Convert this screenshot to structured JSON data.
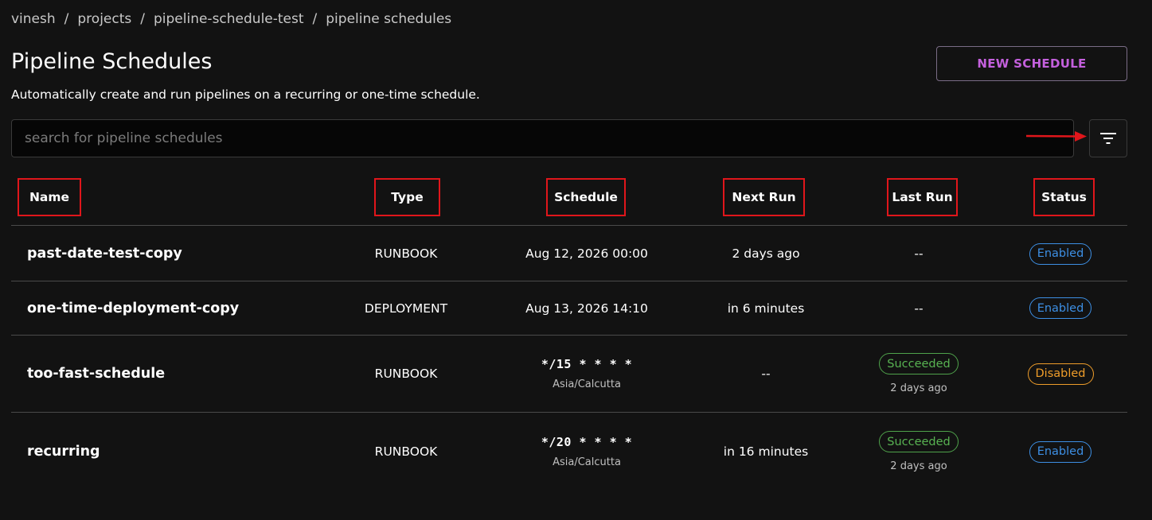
{
  "breadcrumb": {
    "items": [
      "vinesh",
      "projects",
      "pipeline-schedule-test",
      "pipeline schedules"
    ],
    "separator": "/"
  },
  "header": {
    "title": "Pipeline Schedules",
    "subtitle": "Automatically create and run pipelines on a recurring or one-time schedule.",
    "new_button_label": "NEW SCHEDULE"
  },
  "search": {
    "placeholder": "search for pipeline schedules",
    "value": ""
  },
  "filter": {
    "icon": "filter-icon"
  },
  "table": {
    "columns": [
      "Name",
      "Type",
      "Schedule",
      "Next Run",
      "Last Run",
      "Status"
    ],
    "rows": [
      {
        "name": "past-date-test-copy",
        "type": "RUNBOOK",
        "schedule": "Aug 12, 2026 00:00",
        "timezone": "",
        "next_run": "2 days ago",
        "last_run_status": "",
        "last_run_text": "--",
        "last_run_ago": "",
        "status": "Enabled"
      },
      {
        "name": "one-time-deployment-copy",
        "type": "DEPLOYMENT",
        "schedule": "Aug 13, 2026 14:10",
        "timezone": "",
        "next_run": "in 6 minutes",
        "last_run_status": "",
        "last_run_text": "--",
        "last_run_ago": "",
        "status": "Enabled"
      },
      {
        "name": "too-fast-schedule",
        "type": "RUNBOOK",
        "schedule": "*/15 * * * *",
        "timezone": "Asia/Calcutta",
        "next_run": "--",
        "last_run_status": "Succeeded",
        "last_run_text": "",
        "last_run_ago": "2 days ago",
        "status": "Disabled"
      },
      {
        "name": "recurring",
        "type": "RUNBOOK",
        "schedule": "*/20 * * * *",
        "timezone": "Asia/Calcutta",
        "next_run": "in 16 minutes",
        "last_run_status": "Succeeded",
        "last_run_text": "",
        "last_run_ago": "2 days ago",
        "status": "Enabled"
      }
    ]
  },
  "colors": {
    "background": "#121212",
    "accent_purple": "#c460dd",
    "enabled_blue": "#3d8fe4",
    "disabled_orange": "#ef9d2a",
    "succeeded_green": "#58b352",
    "annotation_red": "#e0161b"
  }
}
